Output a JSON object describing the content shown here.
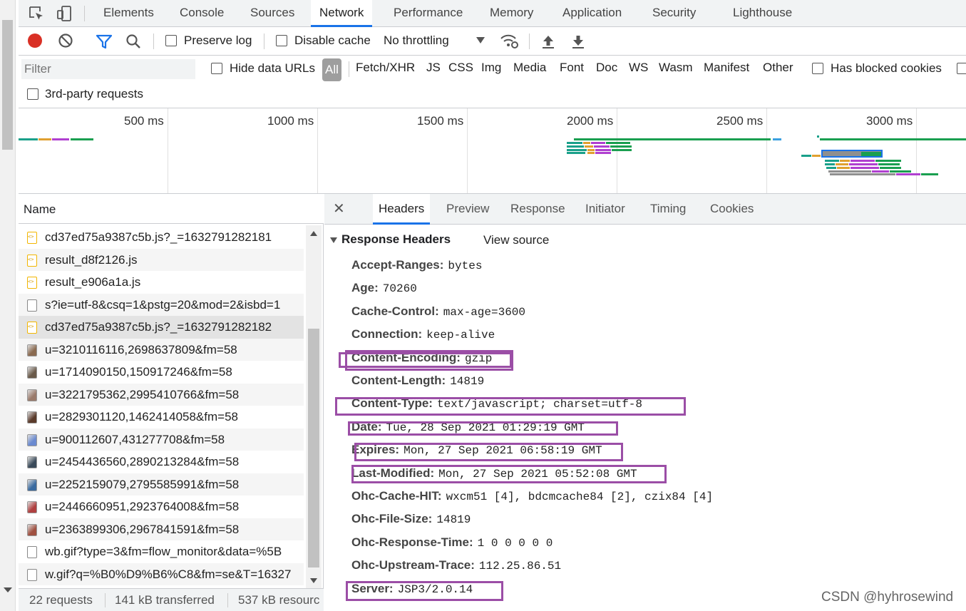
{
  "tabs": [
    "Elements",
    "Console",
    "Sources",
    "Network",
    "Performance",
    "Memory",
    "Application",
    "Security",
    "Lighthouse"
  ],
  "active_tab": "Network",
  "toolbar": {
    "preserve_log": "Preserve log",
    "disable_cache": "Disable cache",
    "throttling": "No throttling"
  },
  "filter": {
    "placeholder": "Filter",
    "hide_data_urls": "Hide data URLs",
    "all": "All",
    "types": [
      "Fetch/XHR",
      "JS",
      "CSS",
      "Img",
      "Media",
      "Font",
      "Doc",
      "WS",
      "Wasm",
      "Manifest",
      "Other"
    ],
    "has_blocked_cookies": "Has blocked cookies",
    "third_party": "3rd-party requests"
  },
  "overview": {
    "ticks": [
      "500 ms",
      "1000 ms",
      "1500 ms",
      "2000 ms",
      "2500 ms",
      "3000 ms"
    ]
  },
  "request_list": {
    "header": "Name",
    "rows": [
      {
        "name": "cd37ed75a9387c5b.js?_=1632791282181",
        "icon": "js"
      },
      {
        "name": "result_d8f2126.js",
        "icon": "js"
      },
      {
        "name": "result_e906a1a.js",
        "icon": "js"
      },
      {
        "name": "s?ie=utf-8&csq=1&pstg=20&mod=2&isbd=1",
        "icon": "doc"
      },
      {
        "name": "cd37ed75a9387c5b.js?_=1632791282182",
        "icon": "js",
        "selected": true
      },
      {
        "name": "u=3210116116,2698637809&fm=58",
        "icon": "img"
      },
      {
        "name": "u=1714090150,150917246&fm=58",
        "icon": "img"
      },
      {
        "name": "u=3221795362,2995410766&fm=58",
        "icon": "img"
      },
      {
        "name": "u=2829301120,1462414058&fm=58",
        "icon": "img"
      },
      {
        "name": "u=900112607,431277708&fm=58",
        "icon": "img"
      },
      {
        "name": "u=2454436560,2890213284&fm=58",
        "icon": "img"
      },
      {
        "name": "u=2252159079,2795585991&fm=58",
        "icon": "img"
      },
      {
        "name": "u=2446660951,2923764008&fm=58",
        "icon": "img"
      },
      {
        "name": "u=2363899306,2967841591&fm=58",
        "icon": "img"
      },
      {
        "name": "wb.gif?type=3&fm=flow_monitor&data=%5B",
        "icon": "doc"
      },
      {
        "name": "w.gif?q=%B0%D9%B6%C8&fm=se&T=16327",
        "icon": "doc"
      }
    ]
  },
  "status": {
    "requests": "22 requests",
    "transferred": "141 kB transferred",
    "resources": "537 kB resourc"
  },
  "details": {
    "tabs": [
      "Headers",
      "Preview",
      "Response",
      "Initiator",
      "Timing",
      "Cookies"
    ],
    "active": "Headers",
    "section_title": "Response Headers",
    "view_source": "View source",
    "headers": [
      {
        "key": "Accept-Ranges:",
        "value": "bytes",
        "highlighted": false
      },
      {
        "key": "Age:",
        "value": "70260",
        "highlighted": false
      },
      {
        "key": "Cache-Control:",
        "value": "max-age=3600",
        "highlighted": false
      },
      {
        "key": "Connection:",
        "value": "keep-alive",
        "highlighted": false
      },
      {
        "key": "Content-Encoding:",
        "value": "gzip",
        "highlighted": true
      },
      {
        "key": "Content-Length:",
        "value": "14819",
        "highlighted": true
      },
      {
        "key": "Content-Type:",
        "value": "text/javascript; charset=utf-8",
        "highlighted": true
      },
      {
        "key": "Date:",
        "value": "Tue, 28 Sep 2021 01:29:19 GMT",
        "highlighted": true
      },
      {
        "key": "Expires:",
        "value": "Mon, 27 Sep 2021 06:58:19 GMT",
        "highlighted": true
      },
      {
        "key": "Last-Modified:",
        "value": "Mon, 27 Sep 2021 05:52:08 GMT",
        "highlighted": true
      },
      {
        "key": "Ohc-Cache-HIT:",
        "value": "wxcm51 [4], bdcmcache84 [2], czix84 [4]",
        "highlighted": false
      },
      {
        "key": "Ohc-File-Size:",
        "value": "14819",
        "highlighted": false
      },
      {
        "key": "Ohc-Response-Time:",
        "value": "1 0 0 0 0 0",
        "highlighted": false
      },
      {
        "key": "Ohc-Upstream-Trace:",
        "value": "112.25.86.51",
        "highlighted": false
      },
      {
        "key": "Server:",
        "value": "JSP3/2.0.14",
        "highlighted": true
      }
    ]
  },
  "watermark": "CSDN @hyhrosewind",
  "colors": {
    "accent": "#1a73e8",
    "record": "#d93025",
    "highlight_box": "#9b4ea6"
  }
}
